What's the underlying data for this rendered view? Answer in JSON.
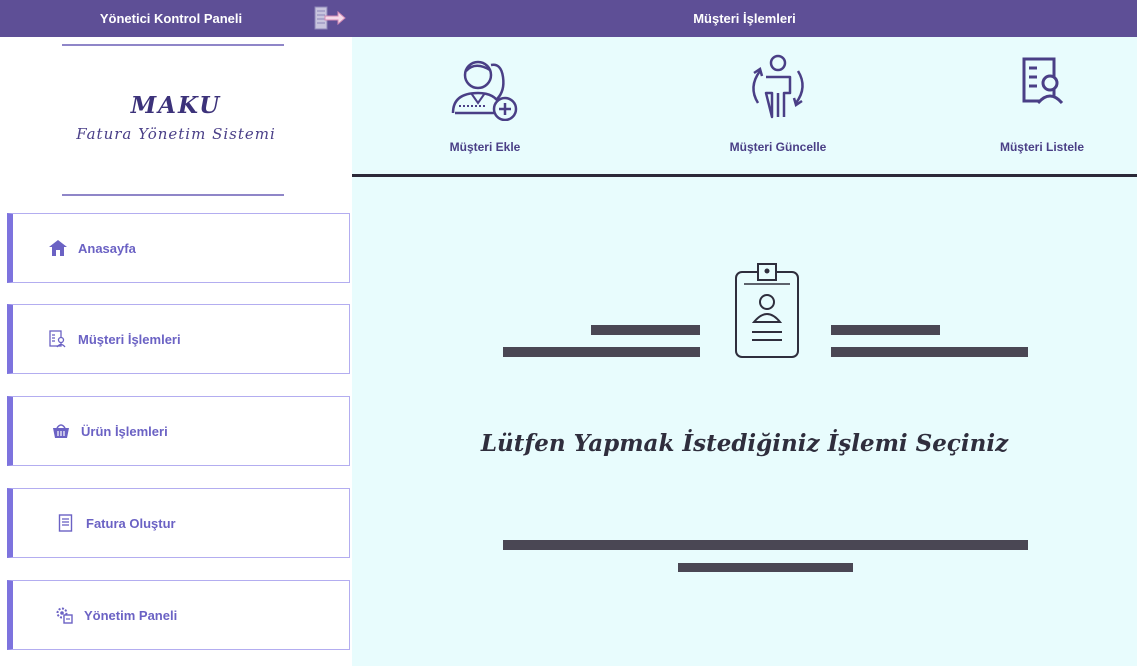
{
  "header": {
    "sidebar_title": "Yönetici Kontrol Paneli",
    "page_title": "Müşteri İşlemleri",
    "logout_icon": "logout-arrow-icon"
  },
  "brand": {
    "title": "MAKU",
    "subtitle": "Fatura Yönetim Sistemi"
  },
  "sidebar": {
    "items": [
      {
        "label": "Anasayfa",
        "icon": "home-icon"
      },
      {
        "label": "Müşteri İşlemleri",
        "icon": "customer-list-icon"
      },
      {
        "label": "Ürün İşlemleri",
        "icon": "basket-icon"
      },
      {
        "label": "Fatura Oluştur",
        "icon": "invoice-icon"
      },
      {
        "label": "Yönetim Paneli",
        "icon": "settings-panel-icon"
      }
    ]
  },
  "toolbar": {
    "buttons": [
      {
        "label": "Müşteri Ekle",
        "icon": "add-customer-icon"
      },
      {
        "label": "Müşteri Güncelle",
        "icon": "update-customer-icon"
      },
      {
        "label": "Müşteri Listele",
        "icon": "list-customers-icon"
      }
    ]
  },
  "main": {
    "prompt": "Lütfen Yapmak İstediğiniz İşlemi Seçiniz",
    "badge_icon": "id-badge-icon"
  },
  "colors": {
    "header_bg": "#5e4f96",
    "main_bg": "#e8fcfd",
    "accent": "#7d73de",
    "dark_lines": "#4a4754"
  }
}
